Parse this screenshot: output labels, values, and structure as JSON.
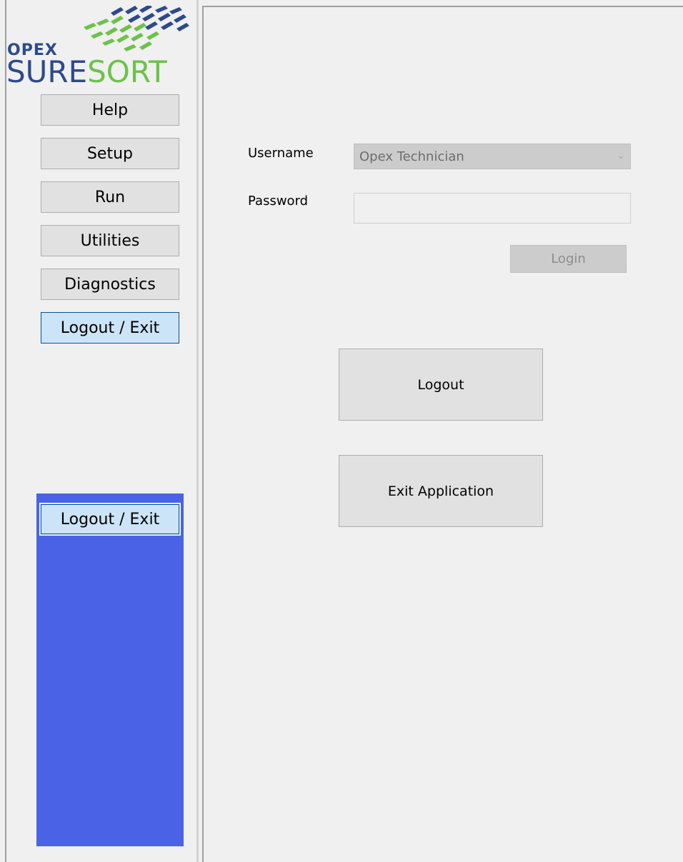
{
  "logo": {
    "brand_small": "OPEX",
    "brand_word_1": "SURE",
    "brand_word_2": "SORT",
    "colors": {
      "navy": "#2d4a8a",
      "green": "#6cc24a"
    }
  },
  "sidebar": {
    "items": [
      {
        "label": "Help"
      },
      {
        "label": "Setup"
      },
      {
        "label": "Run"
      },
      {
        "label": "Utilities"
      },
      {
        "label": "Diagnostics"
      },
      {
        "label": "Logout / Exit",
        "active": true
      }
    ],
    "submenu": {
      "items": [
        {
          "label": "Logout / Exit",
          "active": true
        }
      ],
      "panel_color": "#4a63e6"
    }
  },
  "login": {
    "username_label": "Username",
    "username_value": "Opex Technician",
    "password_label": "Password",
    "password_value": "",
    "login_label": "Login"
  },
  "actions": {
    "logout_label": "Logout",
    "exit_label": "Exit Application"
  }
}
